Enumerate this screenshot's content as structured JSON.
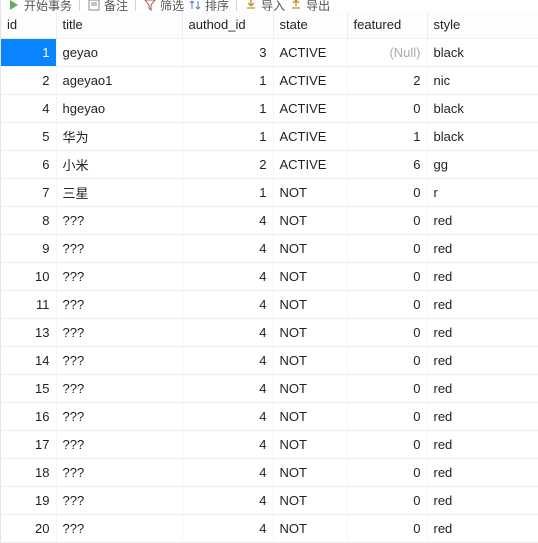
{
  "toolbar": {
    "begin_label": "开始事务",
    "memo_label": "备注",
    "filter_label": "筛选",
    "sort_label": "排序",
    "import_label": "导入",
    "export_label": "导出"
  },
  "columns": {
    "id": "id",
    "title": "title",
    "authod_id": "authod_id",
    "state": "state",
    "featured": "featured",
    "style": "style"
  },
  "null_text": "(Null)",
  "rows": [
    {
      "id": 1,
      "title": "geyao",
      "authod_id": 3,
      "state": "ACTIVE",
      "featured": null,
      "style": "black",
      "selected": true
    },
    {
      "id": 2,
      "title": "ageyao1",
      "authod_id": 1,
      "state": "ACTIVE",
      "featured": 2,
      "style": "nic"
    },
    {
      "id": 4,
      "title": "hgeyao",
      "authod_id": 1,
      "state": "ACTIVE",
      "featured": 0,
      "style": "black"
    },
    {
      "id": 5,
      "title": "华为",
      "authod_id": 1,
      "state": "ACTIVE",
      "featured": 1,
      "style": "black"
    },
    {
      "id": 6,
      "title": "小米",
      "authod_id": 2,
      "state": "ACTIVE",
      "featured": 6,
      "style": "gg"
    },
    {
      "id": 7,
      "title": "三星",
      "authod_id": 1,
      "state": "NOT",
      "featured": 0,
      "style": "r"
    },
    {
      "id": 8,
      "title": "???",
      "authod_id": 4,
      "state": "NOT",
      "featured": 0,
      "style": "red"
    },
    {
      "id": 9,
      "title": "???",
      "authod_id": 4,
      "state": "NOT",
      "featured": 0,
      "style": "red"
    },
    {
      "id": 10,
      "title": "???",
      "authod_id": 4,
      "state": "NOT",
      "featured": 0,
      "style": "red"
    },
    {
      "id": 11,
      "title": "???",
      "authod_id": 4,
      "state": "NOT",
      "featured": 0,
      "style": "red"
    },
    {
      "id": 13,
      "title": "???",
      "authod_id": 4,
      "state": "NOT",
      "featured": 0,
      "style": "red"
    },
    {
      "id": 14,
      "title": "???",
      "authod_id": 4,
      "state": "NOT",
      "featured": 0,
      "style": "red"
    },
    {
      "id": 15,
      "title": "???",
      "authod_id": 4,
      "state": "NOT",
      "featured": 0,
      "style": "red"
    },
    {
      "id": 16,
      "title": "???",
      "authod_id": 4,
      "state": "NOT",
      "featured": 0,
      "style": "red"
    },
    {
      "id": 17,
      "title": "???",
      "authod_id": 4,
      "state": "NOT",
      "featured": 0,
      "style": "red"
    },
    {
      "id": 18,
      "title": "???",
      "authod_id": 4,
      "state": "NOT",
      "featured": 0,
      "style": "red"
    },
    {
      "id": 19,
      "title": "???",
      "authod_id": 4,
      "state": "NOT",
      "featured": 0,
      "style": "red"
    },
    {
      "id": 20,
      "title": "???",
      "authod_id": 4,
      "state": "NOT",
      "featured": 0,
      "style": "red"
    }
  ]
}
